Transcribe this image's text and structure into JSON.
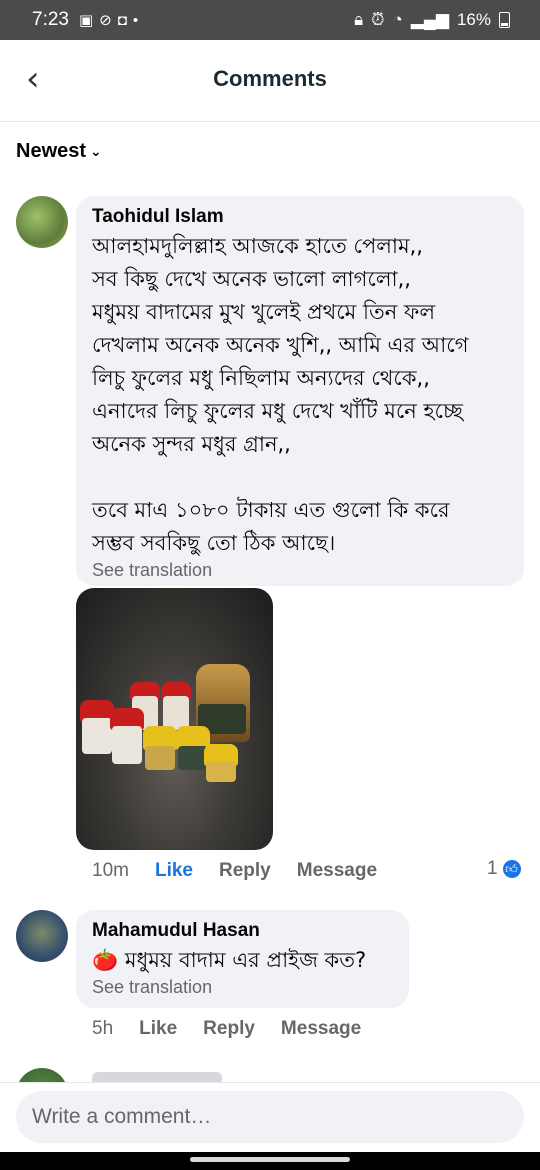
{
  "status_bar": {
    "time": "7:23",
    "battery": "16%",
    "left_icons": [
      "screenshot-icon",
      "blocked-icon",
      "notification-icon",
      "dot-icon"
    ],
    "right_icons": [
      "lock-icon",
      "alarm-icon",
      "wifi-icon",
      "signal-icon",
      "battery-icon"
    ]
  },
  "header": {
    "title": "Comments",
    "back_icon": "chevron-left-icon"
  },
  "sort": {
    "label": "Newest",
    "icon": "chevron-down-icon"
  },
  "comments": [
    {
      "author": "Taohidul Islam",
      "text": "আলহামদুলিল্লাহ আজকে হাতে পেলাম,,\nসব কিছু দেখে অনেক ভালো লাগলো,,\nমধুময় বাদামের মুখ খুলেই প্রথমে তিন ফল\nদেখলাম অনেক অনেক খুশি,, আমি এর আগে\nলিচু ফুলের মধু নিছিলাম অন্যদের থেকে,,\nএনাদের লিচু ফুলের মধু দেখে খাঁটি মনে হচ্ছে\nঅনেক সুন্দর মধুর গ্রান,,\n\nতবে মাএ ১০৮০ টাকায় এত গুলো  কি করে\nসম্ভব সবকিছু তো ঠিক আছে।",
      "see_translation": "See translation",
      "time": "10m",
      "like": "Like",
      "reply": "Reply",
      "message": "Message",
      "reaction_count": "1",
      "reaction_icon": "like-icon",
      "has_photo": true
    },
    {
      "author": "Mahamudul Hasan",
      "text": "🍅 মধুময় বাদাম এর প্রাইজ কত?",
      "see_translation": "See translation",
      "time": "5h",
      "like": "Like",
      "reply": "Reply",
      "message": "Message"
    }
  ],
  "composer": {
    "placeholder": "Write a comment…"
  },
  "colors": {
    "status_bar": "#4b4b4b",
    "bubble": "#f0f2f5",
    "accent_blue": "#1b74e4",
    "secondary_text": "#65676b"
  }
}
